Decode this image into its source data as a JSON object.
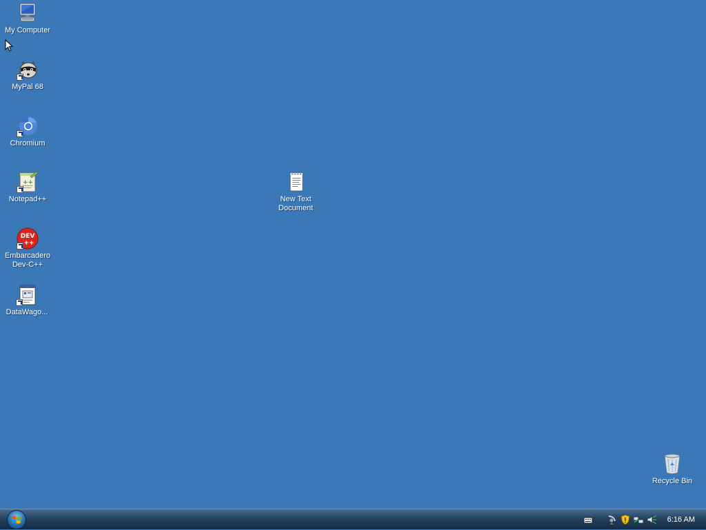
{
  "desktop": {
    "background_color": "#3b78b8",
    "icons": [
      {
        "label": "My Computer",
        "icon": "my-computer-icon",
        "shortcut": false
      },
      {
        "label": "MyPal 68",
        "icon": "mypal-raccoon-icon",
        "shortcut": true
      },
      {
        "label": "Chromium",
        "icon": "chromium-icon",
        "shortcut": true
      },
      {
        "label": "Notepad++",
        "icon": "notepad-plus-plus-icon",
        "shortcut": true
      },
      {
        "label": "Embarcadero\nDev-C++",
        "icon": "dev-cpp-icon",
        "shortcut": true
      },
      {
        "label": "DataWago...",
        "icon": "datawagon-icon",
        "shortcut": true
      },
      {
        "label": "New Text\nDocument",
        "icon": "text-document-icon",
        "shortcut": false
      },
      {
        "label": "Recycle Bin",
        "icon": "recycle-bin-icon",
        "shortcut": false
      }
    ]
  },
  "taskbar": {
    "start_icon": "windows-logo-icon",
    "tray_icons": [
      "keyboard-icon",
      "shield-icon",
      "network-icon",
      "volume-icon"
    ],
    "clock": "6:16 AM"
  }
}
